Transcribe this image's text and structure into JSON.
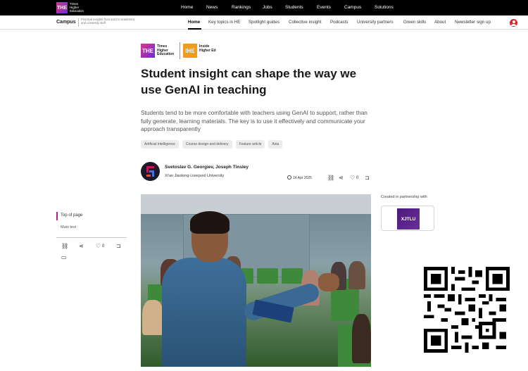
{
  "topbar": {
    "logo_text": "THE",
    "logo_subtext": "Times Higher Education",
    "nav": [
      "Home",
      "News",
      "Rankings",
      "Jobs",
      "Students",
      "Events",
      "Campus",
      "Solutions"
    ]
  },
  "subbar": {
    "section": "Campus",
    "tagline": "Practical insights from and for academics and university staff",
    "nav": [
      "Home",
      "Key topics in HE",
      "Spotlight guides",
      "Collective insight",
      "Podcasts",
      "University partners",
      "Green skills",
      "About",
      "Newsletter sign up"
    ],
    "active": "Home"
  },
  "brands": {
    "the_mark": "THE",
    "the_text": "Times Higher Education",
    "ihe_mark": "IHE",
    "ihe_text": "Inside Higher Ed"
  },
  "article": {
    "title": "Student insight can shape the way we use GenAI in teaching",
    "lead": "Students tend to be more comfortable with teachers using GenAI to support, rather than fully generate, learning materials. The key is to use it effectively and communicate your approach transparently",
    "tags": [
      "Artificial intelligence",
      "Course design and delivery",
      "Feature article",
      "Asia"
    ],
    "authors": "Svetoslav G. Georgiev, Joseph Tinsley",
    "affiliation": "Xi'an Jiaotong-Liverpool University",
    "date": "14 Apr 2025",
    "like_count": "0"
  },
  "sidebar": {
    "top_of_page": "Top of page",
    "main_text": "Main text",
    "like_count": "0"
  },
  "partner": {
    "label": "Created in partnership with",
    "logo_text": "XJTLU"
  },
  "colors": {
    "brand_gradient_start": "#e0338f",
    "brand_gradient_end": "#6a2bd8",
    "ihe_orange": "#f09b1d",
    "user_icon_red": "#d6262e",
    "toc_accent": "#b0238f"
  }
}
